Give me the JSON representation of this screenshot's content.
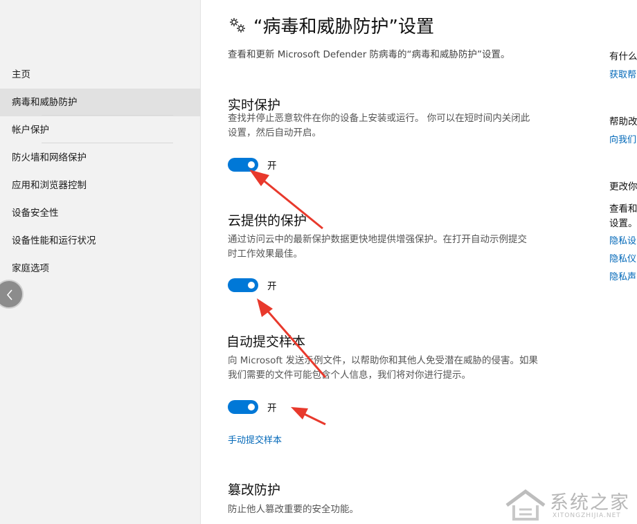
{
  "sidebar": {
    "items": [
      {
        "label": "主页"
      },
      {
        "label": "病毒和威胁防护"
      },
      {
        "label": "帐户保护"
      },
      {
        "label": "防火墙和网络保护"
      },
      {
        "label": "应用和浏览器控制"
      },
      {
        "label": "设备安全性"
      },
      {
        "label": "设备性能和运行状况"
      },
      {
        "label": "家庭选项"
      }
    ],
    "active_index": 1,
    "back_icon": "chevron-left-icon"
  },
  "header": {
    "icon": "gear-icon",
    "title": "“病毒和威胁防护”设置",
    "description": "查看和更新 Microsoft Defender 防病毒的“病毒和威胁防护”设置。"
  },
  "sections": {
    "realtime": {
      "title": "实时保护",
      "desc_line1": "查找并停止恶意软件在你的设备上安装或运行。 你可以在短时间内关闭此",
      "desc_line2": "设置，然后自动开启。",
      "toggle_label": "开",
      "toggle_on": true
    },
    "cloud": {
      "title": "云提供的保护",
      "desc_line1": "通过访问云中的最新保护数据更快地提供增强保护。在打开自动示例提交",
      "desc_line2": "时工作效果最佳。",
      "toggle_label": "开",
      "toggle_on": true
    },
    "sample": {
      "title": "自动提交样本",
      "desc_line1": "向 Microsoft 发送示例文件，以帮助你和其他人免受潜在威胁的侵害。如果",
      "desc_line2": "我们需要的文件可能包含个人信息，我们将对你进行提示。",
      "toggle_label": "开",
      "toggle_on": true,
      "link": "手动提交样本"
    },
    "tamper": {
      "title": "篡改防护",
      "desc_line1": "防止他人篡改重要的安全功能。"
    }
  },
  "right_panel": {
    "q_title": "有什么",
    "q_link": "获取帮",
    "help_title": "帮助改",
    "help_link": "向我们",
    "privacy_title": "更改你",
    "privacy_desc1": "查看和",
    "privacy_desc2": "设置。",
    "privacy_link1": "隐私设",
    "privacy_link2": "隐私仪",
    "privacy_link3": "隐私声"
  },
  "watermark": {
    "main": "系统之家",
    "sub": "XITONGZHIJIA.NET"
  },
  "colors": {
    "accent": "#0078d7",
    "link": "#0067b8",
    "arrow": "#e8392c",
    "sidebar_bg": "#f2f2f2"
  }
}
